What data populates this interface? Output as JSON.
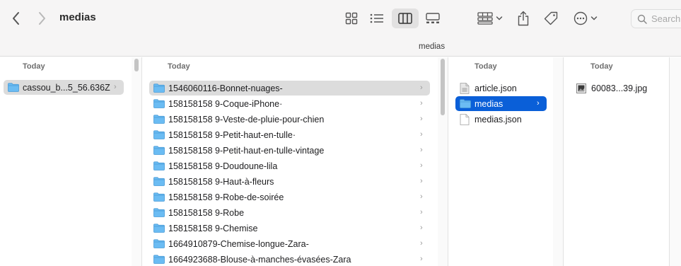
{
  "toolbar": {
    "title": "medias",
    "search_placeholder": "Search"
  },
  "pathbar": {
    "label": "medias"
  },
  "columns": [
    {
      "header": "Today",
      "items": [
        {
          "label": "cassou_b...5_56.636Z",
          "kind": "folder",
          "selected": "gray"
        }
      ]
    },
    {
      "header": "Today",
      "items": [
        {
          "label": "1546060116-Bonnet-nuages-",
          "kind": "folder",
          "selected": "gray"
        },
        {
          "label": "158158158 9-Coque-iPhone·",
          "kind": "folder"
        },
        {
          "label": "158158158 9-Veste-de-pluie-pour-chien",
          "kind": "folder"
        },
        {
          "label": "158158158 9-Petit-haut-en-tulle·",
          "kind": "folder"
        },
        {
          "label": "158158158 9-Petit-haut-en-tulle-vintage",
          "kind": "folder"
        },
        {
          "label": "158158158 9-Doudoune-lila",
          "kind": "folder"
        },
        {
          "label": "158158158 9-Haut-à-fleurs",
          "kind": "folder"
        },
        {
          "label": "158158158 9-Robe-de-soirée",
          "kind": "folder"
        },
        {
          "label": "158158158 9-Robe",
          "kind": "folder"
        },
        {
          "label": "158158158 9-Chemise",
          "kind": "folder"
        },
        {
          "label": "1664910879-Chemise-longue-Zara-",
          "kind": "folder"
        },
        {
          "label": "1664923688-Blouse-à-manches-évasées-Zara",
          "kind": "folder"
        }
      ]
    },
    {
      "header": "Today",
      "items": [
        {
          "label": "article.json",
          "kind": "json"
        },
        {
          "label": "medias",
          "kind": "folder",
          "selected": "blue"
        },
        {
          "label": "medias.json",
          "kind": "file"
        }
      ]
    },
    {
      "header": "Today",
      "items": [
        {
          "label": "60083...39.jpg",
          "kind": "image"
        }
      ]
    }
  ],
  "colors": {
    "folder": "#6bbcf3",
    "selection_blue": "#0a5fd8",
    "selection_gray": "#dcdcdc"
  }
}
